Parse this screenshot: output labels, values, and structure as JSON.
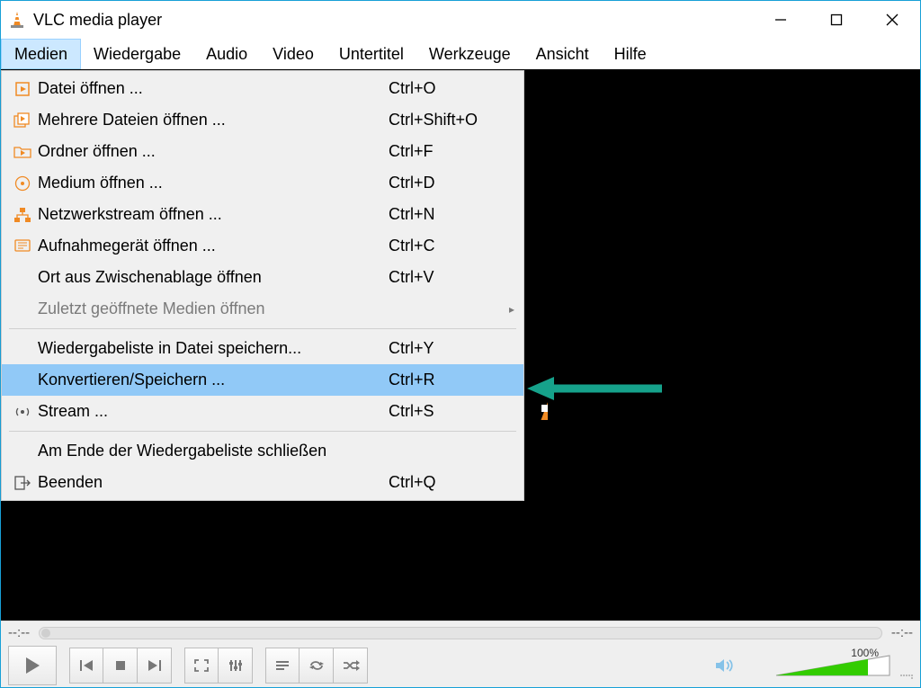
{
  "window": {
    "title": "VLC media player"
  },
  "menubar": {
    "items": [
      "Medien",
      "Wiedergabe",
      "Audio",
      "Video",
      "Untertitel",
      "Werkzeuge",
      "Ansicht",
      "Hilfe"
    ],
    "active_index": 0
  },
  "dropdown": {
    "items": [
      {
        "icon": "file-play",
        "label": "Datei öffnen ...",
        "shortcut": "Ctrl+O"
      },
      {
        "icon": "files-play",
        "label": "Mehrere Dateien öffnen ...",
        "shortcut": "Ctrl+Shift+O"
      },
      {
        "icon": "folder-play",
        "label": "Ordner öffnen ...",
        "shortcut": "Ctrl+F"
      },
      {
        "icon": "disc",
        "label": "Medium öffnen ...",
        "shortcut": "Ctrl+D"
      },
      {
        "icon": "network",
        "label": "Netzwerkstream öffnen ...",
        "shortcut": "Ctrl+N"
      },
      {
        "icon": "capture",
        "label": "Aufnahmegerät öffnen ...",
        "shortcut": "Ctrl+C"
      },
      {
        "icon": "",
        "label": "Ort aus Zwischenablage öffnen",
        "shortcut": "Ctrl+V"
      },
      {
        "icon": "",
        "label": "Zuletzt geöffnete Medien öffnen",
        "shortcut": "",
        "disabled": true,
        "submenu": true
      },
      {
        "sep": true
      },
      {
        "icon": "",
        "label": "Wiedergabeliste in Datei speichern...",
        "shortcut": "Ctrl+Y"
      },
      {
        "icon": "",
        "label": "Konvertieren/Speichern ...",
        "shortcut": "Ctrl+R",
        "highlighted": true
      },
      {
        "icon": "stream",
        "label": "Stream ...",
        "shortcut": "Ctrl+S"
      },
      {
        "sep": true
      },
      {
        "icon": "",
        "label": "Am Ende der Wiedergabeliste schließen",
        "shortcut": ""
      },
      {
        "icon": "exit",
        "label": "Beenden",
        "shortcut": "Ctrl+Q"
      }
    ]
  },
  "player": {
    "time_elapsed": "--:--",
    "time_total": "--:--",
    "volume_pct": "100%"
  },
  "colors": {
    "window_border": "#18a0d7",
    "menu_highlight": "#91c9f7",
    "accent_orange": "#f08a24",
    "arrow": "#16a28b",
    "volume_fill": "#33cc00"
  }
}
